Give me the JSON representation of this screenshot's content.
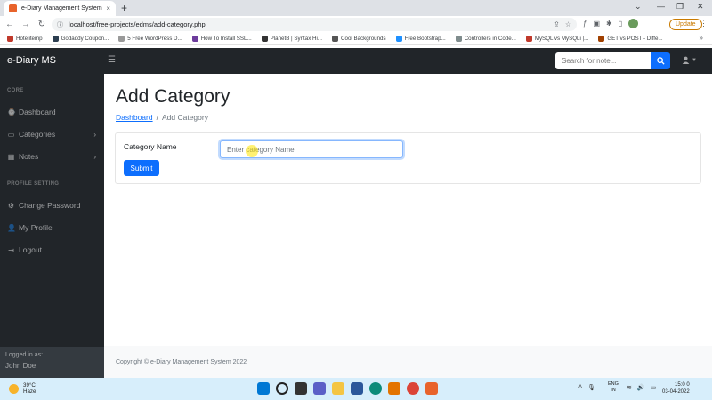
{
  "browser": {
    "tab_title": "e-Diary Management System",
    "tab_close": "×",
    "new_tab": "+",
    "url": "localhost/free-projects/edms/add-category.php",
    "update_label": "Update",
    "bookmarks": [
      {
        "label": "Hotelitemp",
        "color": "#c0392b"
      },
      {
        "label": "Godaddy Coupon...",
        "color": "#2c3e50"
      },
      {
        "label": "5 Free WordPress D...",
        "color": "#999999"
      },
      {
        "label": "How To Install SSL...",
        "color": "#6d3c9c"
      },
      {
        "label": "PlanetB | Syntax Hi...",
        "color": "#333333"
      },
      {
        "label": "Cool Backgrounds",
        "color": "#555555"
      },
      {
        "label": "Free Bootstrap...",
        "color": "#1e90ff"
      },
      {
        "label": "Controllers in Code...",
        "color": "#7f8c8d"
      },
      {
        "label": "MySQL vs MySQLi |...",
        "color": "#c0392b"
      },
      {
        "label": "GET vs POST - Diffe...",
        "color": "#a04000"
      }
    ],
    "bookmarks_more": "»"
  },
  "app": {
    "brand": "e-Diary MS",
    "search_placeholder": "Search for note...",
    "sidebar": {
      "heading_core": "CORE",
      "heading_profile": "PROFILE SETTING",
      "items": [
        {
          "label": "Dashboard",
          "icon": "⌚"
        },
        {
          "label": "Categories",
          "icon": "▭"
        },
        {
          "label": "Notes",
          "icon": "▦"
        },
        {
          "label": "Change Password",
          "icon": "⚙"
        },
        {
          "label": "My Profile",
          "icon": "👤"
        },
        {
          "label": "Logout",
          "icon": "⇥"
        }
      ],
      "logged_in_label": "Logged in as:",
      "logged_in_user": "John Doe"
    },
    "page_title": "Add Category",
    "breadcrumb": {
      "link": "Dashboard",
      "separator": "/",
      "current": "Add Category"
    },
    "form": {
      "field_label": "Category Name",
      "field_placeholder": "Enter category Name",
      "field_value": "",
      "submit_label": "Submit"
    },
    "footer": "Copyright © e-Diary Management System 2022"
  },
  "taskbar": {
    "temperature": "39°C",
    "weather": "Haze",
    "lang_top": "ENG",
    "lang_bottom": "IN",
    "time": "15:0 0",
    "date": "03-04-2022"
  },
  "colors": {
    "primary": "#0d6efd",
    "dark_nav": "#212529",
    "sidebar_footer": "#343a40"
  }
}
